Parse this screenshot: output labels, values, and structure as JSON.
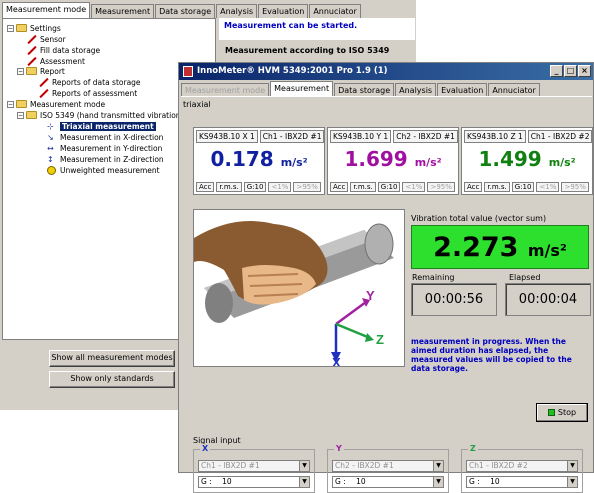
{
  "back_window": {
    "tabs": [
      "Measurement mode",
      "Measurement",
      "Data storage",
      "Analysis",
      "Evaluation",
      "Annuciator"
    ],
    "tree": {
      "settings": "Settings",
      "sensor": "Sensor",
      "fill_data_storage": "Fill data storage",
      "assessment": "Assessment",
      "report": "Report",
      "reports_data_storage": "Reports of data storage",
      "reports_assessment": "Reports of assessment",
      "measurement_mode": "Measurement mode",
      "iso": "ISO 5349 (hand transmitted vibration)",
      "triaxial": "Triaxial measurement",
      "x_dir": "Measurement in X-direction",
      "y_dir": "Measurement in Y-direction",
      "z_dir": "Measurement in Z-direction",
      "unweighted": "Unweighted measurement"
    },
    "status_line": "Measurement can be started.",
    "status_title": "Measurement according to ISO 5349",
    "buttons": {
      "show_all": "Show all measurement modes",
      "show_standards": "Show only standards"
    }
  },
  "front_window": {
    "title": "InnoMeter® HVM 5349:2001 Pro 1.9 (1)",
    "tabs": [
      "Measurement mode",
      "Measurement",
      "Data storage",
      "Analysis",
      "Evaluation",
      "Annuciator"
    ],
    "mode": "triaxial",
    "channels": [
      {
        "sensor": "KS943B.10 X 1",
        "ch": "Ch1 - IBX2D #1",
        "value": "0.178",
        "unit": "m/s²",
        "color": "#1020a0",
        "footer": [
          "Acc",
          "r.m.s.",
          "G:10",
          "<1%",
          ">95%"
        ]
      },
      {
        "sensor": "KS943B.10 Y 1",
        "ch": "Ch2 - IBX2D #1",
        "value": "1.699",
        "unit": "m/s²",
        "color": "#a010a0",
        "footer": [
          "Acc",
          "r.m.s.",
          "G:10",
          "<1%",
          ">95%"
        ]
      },
      {
        "sensor": "KS943B.10 Z 1",
        "ch": "Ch1 - IBX2D #2",
        "value": "1.499",
        "unit": "m/s²",
        "color": "#108010",
        "footer": [
          "Acc",
          "r.m.s.",
          "G:10",
          "<1%",
          ">95%"
        ]
      }
    ],
    "vibration": {
      "label": "Vibration total value (vector sum)",
      "value": "2.273",
      "unit": "m/s²"
    },
    "remaining_label": "Remaining",
    "elapsed_label": "Elapsed",
    "remaining": "00:00:56",
    "elapsed": "00:00:04",
    "message": "measurement in progress. When the aimed duration has elapsed, the measured values will be copied to the data storage.",
    "stop_label": "Stop",
    "axes": {
      "x": "X",
      "y": "Y",
      "z": "Z"
    },
    "signal_input": {
      "label": "Signal input",
      "groups": [
        {
          "axis": "X",
          "channel": "Ch1 - IBX2D #1",
          "gain_label": "G :",
          "gain": "10"
        },
        {
          "axis": "Y",
          "channel": "Ch2 - IBX2D #1",
          "gain_label": "G :",
          "gain": "10"
        },
        {
          "axis": "Z",
          "channel": "Ch1 - IBX2D #2",
          "gain_label": "G :",
          "gain": "10"
        }
      ]
    }
  }
}
